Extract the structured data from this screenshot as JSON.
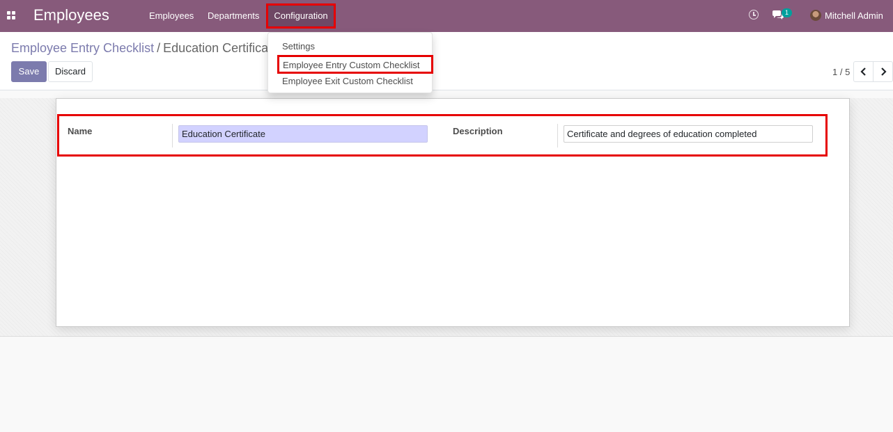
{
  "navbar": {
    "app_title": "Employees",
    "menu": [
      {
        "label": "Employees"
      },
      {
        "label": "Departments"
      },
      {
        "label": "Configuration"
      }
    ],
    "notification_count": "1",
    "user_name": "Mitchell Admin",
    "icons": [
      "apps-icon",
      "clock-icon",
      "chat-icon",
      "avatar"
    ],
    "color": "#875a7b"
  },
  "dropdown": {
    "items": [
      {
        "label": "Settings"
      },
      {
        "label": "Employee Entry Custom Checklist"
      },
      {
        "label": "Employee Exit Custom Checklist"
      }
    ]
  },
  "breadcrumb": {
    "parent": "Employee Entry Checklist",
    "separator": "/",
    "current": "Education Certificate"
  },
  "actions": {
    "save": "Save",
    "discard": "Discard"
  },
  "pager": {
    "value": "1 / 5"
  },
  "form": {
    "name_label": "Name",
    "name_value": "Education Certificate",
    "description_label": "Description",
    "description_value": "Certificate and degrees of education completed"
  },
  "colors": {
    "accent": "#7c7bad",
    "highlight": "#e60000"
  }
}
